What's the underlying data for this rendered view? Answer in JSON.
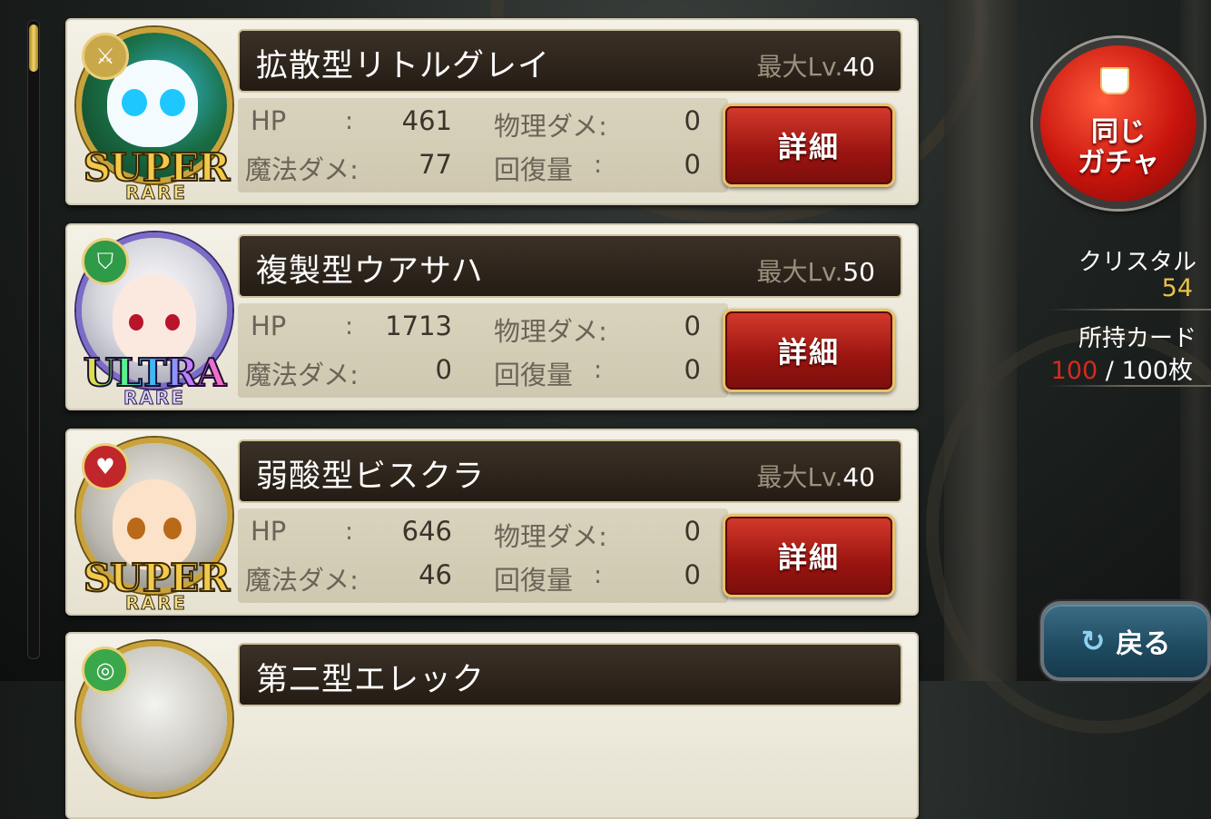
{
  "cards": [
    {
      "name": "拡散型リトルグレイ",
      "max_lv_label": "最大Lv.",
      "max_lv": "40",
      "rarity_big": "SUPER",
      "rarity_small": "RARE",
      "rarity_kind": "super",
      "type_icon": "swords-icon",
      "stats": {
        "hp_label": "HP",
        "hp": "461",
        "phys_label": "物理ダメ:",
        "phys": "0",
        "magic_label": "魔法ダメ:",
        "magic": "77",
        "heal_label": "回復量",
        "heal": "0"
      },
      "detail_label": "詳細"
    },
    {
      "name": "複製型ウアサハ",
      "max_lv_label": "最大Lv.",
      "max_lv": "50",
      "rarity_big": "ULTRA",
      "rarity_small": "RARE",
      "rarity_kind": "ultra",
      "type_icon": "shield-icon",
      "stats": {
        "hp_label": "HP",
        "hp": "1713",
        "phys_label": "物理ダメ:",
        "phys": "0",
        "magic_label": "魔法ダメ:",
        "magic": "0",
        "heal_label": "回復量",
        "heal": "0"
      },
      "detail_label": "詳細"
    },
    {
      "name": "弱酸型ビスクラ",
      "max_lv_label": "最大Lv.",
      "max_lv": "40",
      "rarity_big": "SUPER",
      "rarity_small": "RARE",
      "rarity_kind": "super",
      "type_icon": "heart-icon",
      "stats": {
        "hp_label": "HP",
        "hp": "646",
        "phys_label": "物理ダメ:",
        "phys": "0",
        "magic_label": "魔法ダメ:",
        "magic": "46",
        "heal_label": "回復量",
        "heal": "0"
      },
      "detail_label": "詳細"
    },
    {
      "name": "第二型エレック",
      "type_icon": "swirl-icon"
    }
  ],
  "colon": ":",
  "side": {
    "same_gacha_line1": "同じ",
    "same_gacha_line2": "ガチャ",
    "crystal_label": "クリスタル",
    "crystal_value": "54",
    "owned_label": "所持カード",
    "owned_current": "100",
    "owned_sep": " / ",
    "owned_max": "100枚",
    "back_label": "戻る"
  },
  "colors": {
    "detail_button": "#b0201a",
    "gacha_button": "#c8140d",
    "crystal": "#e8c24a",
    "owned_current": "#d62a1e",
    "back_button": "#1e4a60"
  }
}
